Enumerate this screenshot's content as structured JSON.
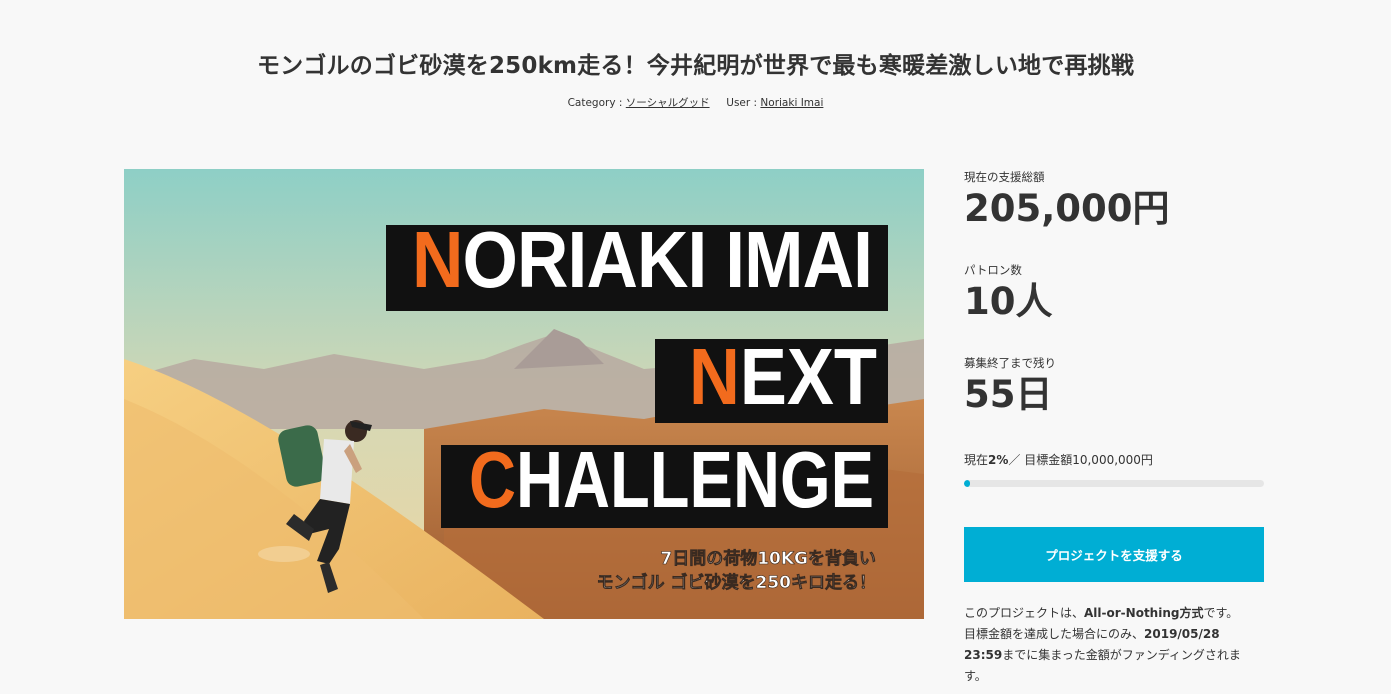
{
  "project": {
    "title": "モンゴルのゴビ砂漠を250km走る！今井紀明が世界で最も寒暖差激しい地で再挑戦",
    "category_prefix": "Category : ",
    "category": "ソーシャルグッド",
    "user_prefix": "User : ",
    "user": "Noriaki Imai"
  },
  "hero": {
    "line1_accent": "N",
    "line1_rest": "ORIAKI IMAI",
    "line2_accent": "N",
    "line2_rest": "EXT",
    "line3_accent": "C",
    "line3_rest": "HALLENGE",
    "caption1": "7日間の荷物10KGを背負い",
    "caption2": "モンゴル ゴビ砂漠を250キロ走る！",
    "accent_color": "#f26b1d"
  },
  "stats": {
    "total_label": "現在の支援総額",
    "total_value": "205,000円",
    "patrons_label": "パトロン数",
    "patrons_value": "10人",
    "remaining_label": "募集終了まで残り",
    "remaining_value": "55日"
  },
  "progress": {
    "prefix": "現在",
    "percent_text": "2%",
    "middle": "／ 目標金額",
    "goal": "10,000,000円",
    "fraction": 0.02,
    "bar_color": "#00aed4"
  },
  "cta": {
    "label": "プロジェクトを支援する"
  },
  "note": {
    "p1": "このプロジェクトは、",
    "p1_bold": "All-or-Nothing方式",
    "p1_end": "です。",
    "p2": "目標金額を達成した場合にのみ、",
    "p2_bold": "2019/05/28 23:59",
    "p3": "までに集まった金額がファンディングされます。"
  }
}
